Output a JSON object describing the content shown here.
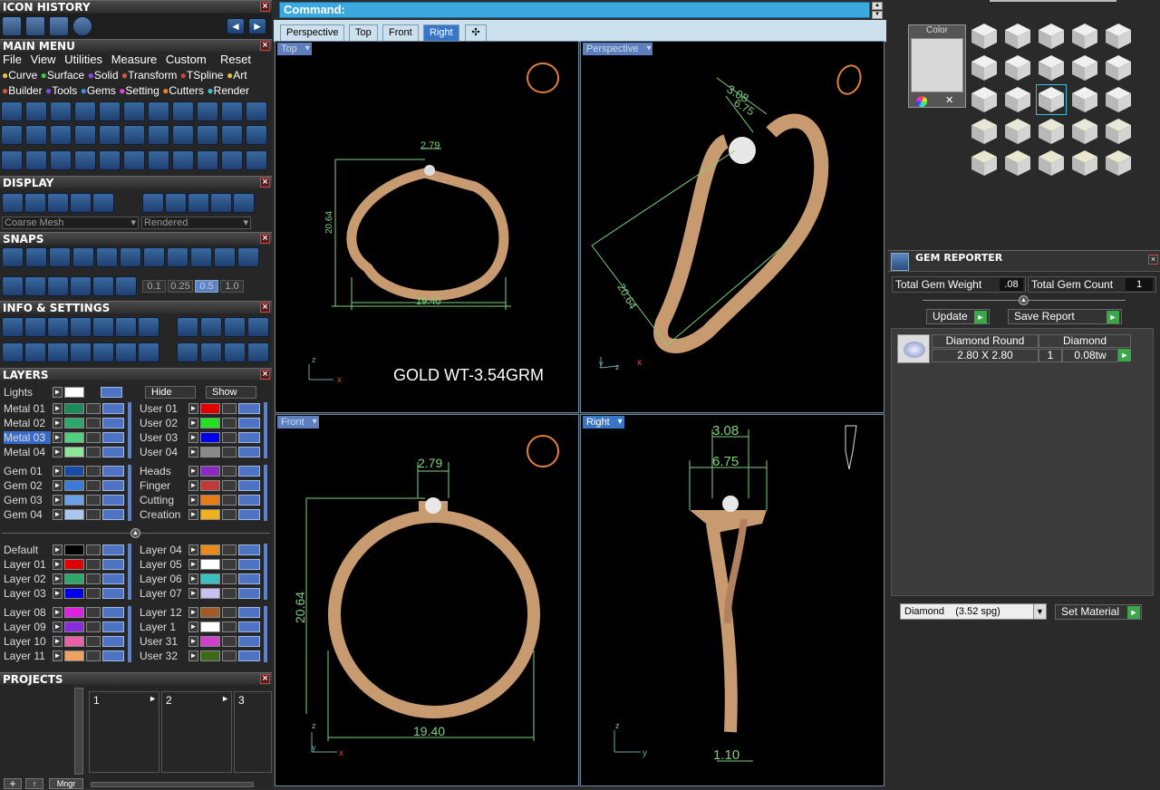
{
  "icon_history": {
    "title": "ICON HISTORY"
  },
  "main_menu": {
    "title": "MAIN MENU",
    "items": [
      "File",
      "View",
      "Utilities",
      "Measure",
      "Custom"
    ],
    "reset": "Reset",
    "row1": [
      "Curve",
      "Surface",
      "Solid",
      "Transform",
      "TSpline",
      "Art"
    ],
    "row2": [
      "Builder",
      "Tools",
      "Gems",
      "Setting",
      "Cutters",
      "Render"
    ]
  },
  "display": {
    "title": "DISPLAY",
    "mesh": "Coarse Mesh",
    "render": "Rendered"
  },
  "snaps": {
    "title": "SNAPS",
    "values": [
      "0.1",
      "0.25",
      "0.5",
      "1.0"
    ]
  },
  "info": {
    "title": "INFO & SETTINGS"
  },
  "layers": {
    "title": "LAYERS",
    "lights": "Lights",
    "hide": "Hide",
    "show": "Show",
    "col1": [
      {
        "name": "Metal 01",
        "color": "#1d8a5a"
      },
      {
        "name": "Metal 02",
        "color": "#2ea86a"
      },
      {
        "name": "Metal 03",
        "color": "#4fcf7f"
      },
      {
        "name": "Metal 04",
        "color": "#8ee69a"
      }
    ],
    "col2": [
      {
        "name": "User 01",
        "color": "#e00000"
      },
      {
        "name": "User 02",
        "color": "#22e022"
      },
      {
        "name": "User 03",
        "color": "#0000e8"
      },
      {
        "name": "User 04",
        "color": "#8a8a8a"
      }
    ],
    "col3": [
      {
        "name": "Gem 01",
        "color": "#1a4aa8"
      },
      {
        "name": "Gem 02",
        "color": "#3a7ad8"
      },
      {
        "name": "Gem 03",
        "color": "#6aa0e8"
      },
      {
        "name": "Gem 04",
        "color": "#a8c8f0"
      }
    ],
    "col4": [
      {
        "name": "Heads",
        "color": "#8a2ac0"
      },
      {
        "name": "Finger",
        "color": "#c03a3a"
      },
      {
        "name": "Cutting",
        "color": "#e87a1a"
      },
      {
        "name": "Creation",
        "color": "#f0b020"
      }
    ],
    "col5": [
      {
        "name": "Default",
        "color": "#000000"
      },
      {
        "name": "Layer 01",
        "color": "#e00000"
      },
      {
        "name": "Layer 02",
        "color": "#2ea86a"
      },
      {
        "name": "Layer 03",
        "color": "#0000e8"
      }
    ],
    "col6": [
      {
        "name": "Layer 04",
        "color": "#e88a1a"
      },
      {
        "name": "Layer 05",
        "color": "#ffffff"
      },
      {
        "name": "Layer 06",
        "color": "#3ac0c0"
      },
      {
        "name": "Layer 07",
        "color": "#c8c0f0"
      }
    ],
    "col7": [
      {
        "name": "Layer 08",
        "color": "#e020e0"
      },
      {
        "name": "Layer 09",
        "color": "#8a2ae0"
      },
      {
        "name": "Layer 10",
        "color": "#e860a8"
      },
      {
        "name": "Layer 11",
        "color": "#f0a060"
      }
    ],
    "col8": [
      {
        "name": "Layer 12",
        "color": "#a05a2a"
      },
      {
        "name": "Layer 1",
        "color": "#ffffff"
      },
      {
        "name": "User 31",
        "color": "#d040d0"
      },
      {
        "name": "User 32",
        "color": "#3a6a1a"
      }
    ]
  },
  "projects": {
    "title": "PROJECTS",
    "slots": [
      "1",
      "2",
      "3"
    ],
    "manager": "Mngr"
  },
  "command": {
    "label": "Command:"
  },
  "tabs": [
    "Perspective",
    "Top",
    "Front",
    "Right"
  ],
  "viewports": {
    "top": "Top",
    "perspective": "Perspective",
    "front": "Front",
    "right": "Right",
    "gold_note": "GOLD WT-3.54GRM"
  },
  "dims": {
    "top_w": "2.79",
    "top_h": "20.64",
    "top_b": "19.40",
    "persp1": "3.08",
    "persp2": "6.75",
    "persp3": "20.64",
    "front_w": "2.79",
    "front_h": "20.64",
    "front_b": "19.40",
    "right1": "3.08",
    "right2": "6.75",
    "right3": "1.10"
  },
  "color_panel": {
    "label": "Color"
  },
  "gem_reporter": {
    "title": "GEM REPORTER",
    "weight_label": "Total Gem Weight",
    "weight": ".08",
    "count_label": "Total Gem Count",
    "count": "1",
    "update": "Update",
    "save": "Save Report",
    "row": {
      "shape": "Diamond Round",
      "size": "2.80 X 2.80",
      "material": "Diamond",
      "qty": "1",
      "tw": "0.08tw"
    },
    "material_select": "Diamond    (3.52 spg)",
    "set_material": "Set Material"
  }
}
